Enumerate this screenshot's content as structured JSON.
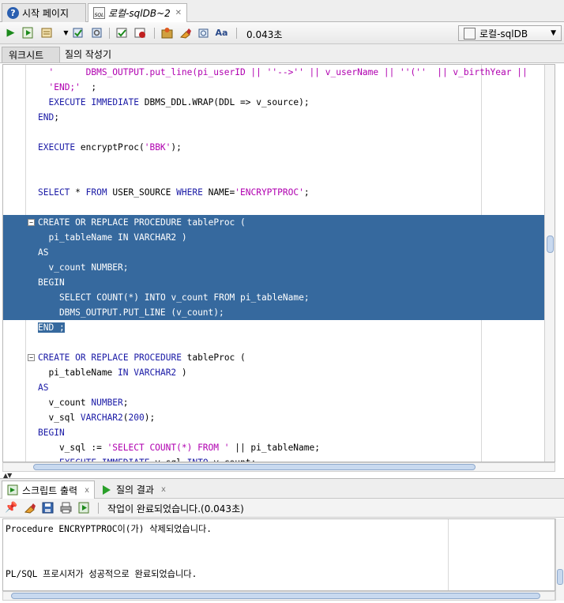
{
  "tabs": [
    {
      "label": "시작 페이지",
      "icon": "help-icon"
    },
    {
      "label": "로컬-sqlDB~2",
      "icon": "sql-worksheet-icon"
    }
  ],
  "toolbar": {
    "elapsed": "0.043초",
    "connection": "로컬-sqlDB",
    "icons": [
      "run-statement-icon",
      "run-script-icon",
      "commit-icon",
      "rollback-icon",
      "explain-plan-icon",
      "autotrace-icon",
      "tuning-advisor-icon",
      "clear-icon",
      "history-icon",
      "format-icon"
    ]
  },
  "subtabs": [
    "워크시트",
    "질의 작성기"
  ],
  "editor": {
    "lines": [
      {
        "text": "  '      DBMS_OUTPUT.put_line(pi_userID || ''-->'' || v_userName || ''(''  || v_birthYear ||",
        "sel": false
      },
      {
        "text": "  'END;'  ;",
        "sel": false
      },
      {
        "text": "  EXECUTE IMMEDIATE DBMS_DDL.WRAP(DDL => v_source);",
        "sel": false
      },
      {
        "text": "END;",
        "sel": false
      },
      {
        "text": "",
        "sel": false
      },
      {
        "text": "EXECUTE encryptProc('BBK');",
        "sel": false
      },
      {
        "text": "",
        "sel": false
      },
      {
        "text": "",
        "sel": false
      },
      {
        "text": "SELECT * FROM USER_SOURCE WHERE NAME='ENCRYPTPROC';",
        "sel": false
      },
      {
        "text": "",
        "sel": false
      },
      {
        "text": "CREATE OR REPLACE PROCEDURE tableProc (",
        "sel": true,
        "fold": true
      },
      {
        "text": "  pi_tableName IN VARCHAR2 )",
        "sel": true
      },
      {
        "text": "AS",
        "sel": true
      },
      {
        "text": "  v_count NUMBER;",
        "sel": true
      },
      {
        "text": "BEGIN",
        "sel": true
      },
      {
        "text": "    SELECT COUNT(*) INTO v_count FROM pi_tableName;",
        "sel": true
      },
      {
        "text": "    DBMS_OUTPUT.PUT_LINE (v_count);",
        "sel": true
      },
      {
        "text": "END ;",
        "sel": true,
        "partial": true
      },
      {
        "text": "",
        "sel": false
      },
      {
        "text": "CREATE OR REPLACE PROCEDURE tableProc (",
        "sel": false,
        "fold": true
      },
      {
        "text": "  pi_tableName IN VARCHAR2 )",
        "sel": false
      },
      {
        "text": "AS",
        "sel": false
      },
      {
        "text": "  v_count NUMBER;",
        "sel": false
      },
      {
        "text": "  v_sql VARCHAR2(200);",
        "sel": false
      },
      {
        "text": "BEGIN",
        "sel": false
      },
      {
        "text": "    v_sql := 'SELECT COUNT(*) FROM ' || pi_tableName;",
        "sel": false
      },
      {
        "text": "    EXECUTE IMMEDIATE v_sql INTO v_count;",
        "sel": false
      }
    ]
  },
  "output": {
    "tabs": [
      {
        "label": "스크립트 출력",
        "icon": "script-output-icon"
      },
      {
        "label": "질의 결과",
        "icon": "query-result-icon"
      }
    ],
    "tab_close": "x",
    "status": "작업이 완료되었습니다.(0.043초)",
    "lines": [
      "Procedure ENCRYPTPROC이(가) 삭제되었습니다.",
      "PL/SQL 프로시저가 성공적으로 완료되었습니다."
    ]
  }
}
